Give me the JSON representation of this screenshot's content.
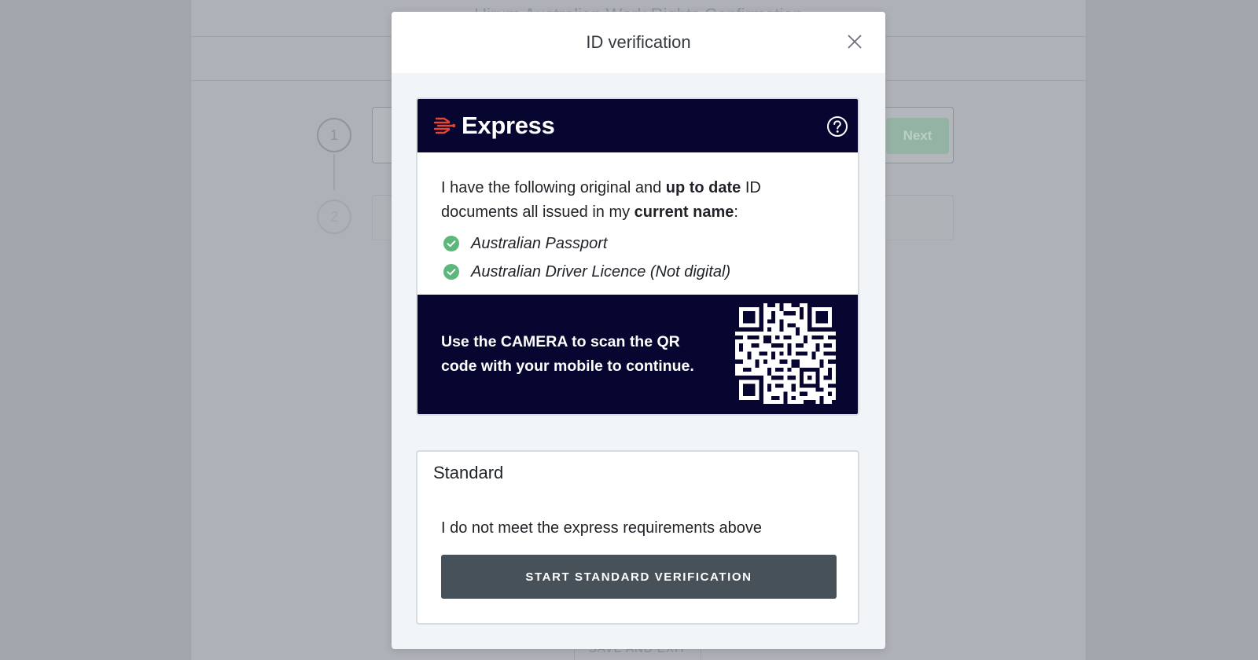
{
  "background": {
    "page_title": "Hirum Australian Work Rights Confirmation",
    "step_1": "1",
    "step_2": "2",
    "next_button": "Next",
    "save_and_exit": "SAVE AND EXIT"
  },
  "modal": {
    "title": "ID verification",
    "close_icon": "close-icon"
  },
  "express": {
    "logo_icon": "express-logo-icon",
    "title": "Express",
    "help_icon": "help-icon",
    "req_part1": "I have the following original and ",
    "req_bold1": "up to date",
    "req_part2": " ID documents all issued in my ",
    "req_bold2": "current name",
    "req_part3": ":",
    "documents": [
      {
        "label": "Australian Passport",
        "icon": "check-circle-icon"
      },
      {
        "label": "Australian Driver Licence (Not digital)",
        "icon": "check-circle-icon"
      }
    ],
    "qr_instruction": "Use the CAMERA to scan the QR code with your mobile to continue.",
    "qr_icon": "qr-code"
  },
  "standard": {
    "title": "Standard",
    "description": "I do not meet the express requirements above",
    "button_label": "START STANDARD VERIFICATION"
  },
  "colors": {
    "navy": "#070630",
    "accent_red": "#e8452e",
    "check_green": "#5cb87a",
    "button_dark": "#47515a",
    "overlay": "#a3a7ad"
  }
}
